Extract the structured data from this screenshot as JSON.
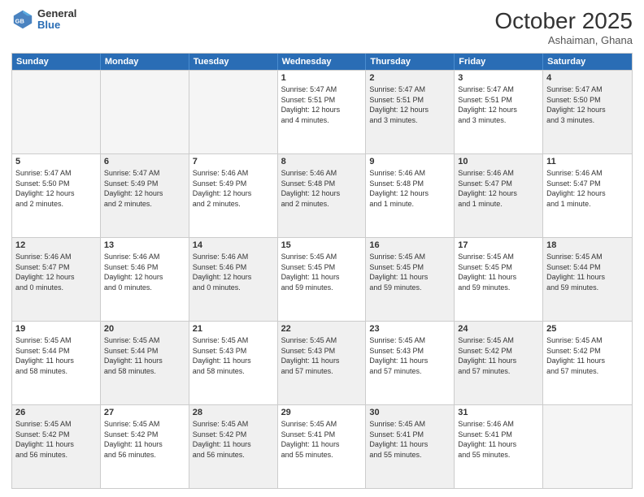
{
  "header": {
    "logo_general": "General",
    "logo_blue": "Blue",
    "month": "October 2025",
    "location": "Ashaiman, Ghana"
  },
  "weekdays": [
    "Sunday",
    "Monday",
    "Tuesday",
    "Wednesday",
    "Thursday",
    "Friday",
    "Saturday"
  ],
  "rows": [
    [
      {
        "day": "",
        "text": "",
        "empty": true
      },
      {
        "day": "",
        "text": "",
        "empty": true
      },
      {
        "day": "",
        "text": "",
        "empty": true
      },
      {
        "day": "1",
        "text": "Sunrise: 5:47 AM\nSunset: 5:51 PM\nDaylight: 12 hours\nand 4 minutes.",
        "shaded": false
      },
      {
        "day": "2",
        "text": "Sunrise: 5:47 AM\nSunset: 5:51 PM\nDaylight: 12 hours\nand 3 minutes.",
        "shaded": true
      },
      {
        "day": "3",
        "text": "Sunrise: 5:47 AM\nSunset: 5:51 PM\nDaylight: 12 hours\nand 3 minutes.",
        "shaded": false
      },
      {
        "day": "4",
        "text": "Sunrise: 5:47 AM\nSunset: 5:50 PM\nDaylight: 12 hours\nand 3 minutes.",
        "shaded": true
      }
    ],
    [
      {
        "day": "5",
        "text": "Sunrise: 5:47 AM\nSunset: 5:50 PM\nDaylight: 12 hours\nand 2 minutes.",
        "shaded": false
      },
      {
        "day": "6",
        "text": "Sunrise: 5:47 AM\nSunset: 5:49 PM\nDaylight: 12 hours\nand 2 minutes.",
        "shaded": true
      },
      {
        "day": "7",
        "text": "Sunrise: 5:46 AM\nSunset: 5:49 PM\nDaylight: 12 hours\nand 2 minutes.",
        "shaded": false
      },
      {
        "day": "8",
        "text": "Sunrise: 5:46 AM\nSunset: 5:48 PM\nDaylight: 12 hours\nand 2 minutes.",
        "shaded": true
      },
      {
        "day": "9",
        "text": "Sunrise: 5:46 AM\nSunset: 5:48 PM\nDaylight: 12 hours\nand 1 minute.",
        "shaded": false
      },
      {
        "day": "10",
        "text": "Sunrise: 5:46 AM\nSunset: 5:47 PM\nDaylight: 12 hours\nand 1 minute.",
        "shaded": true
      },
      {
        "day": "11",
        "text": "Sunrise: 5:46 AM\nSunset: 5:47 PM\nDaylight: 12 hours\nand 1 minute.",
        "shaded": false
      }
    ],
    [
      {
        "day": "12",
        "text": "Sunrise: 5:46 AM\nSunset: 5:47 PM\nDaylight: 12 hours\nand 0 minutes.",
        "shaded": true
      },
      {
        "day": "13",
        "text": "Sunrise: 5:46 AM\nSunset: 5:46 PM\nDaylight: 12 hours\nand 0 minutes.",
        "shaded": false
      },
      {
        "day": "14",
        "text": "Sunrise: 5:46 AM\nSunset: 5:46 PM\nDaylight: 12 hours\nand 0 minutes.",
        "shaded": true
      },
      {
        "day": "15",
        "text": "Sunrise: 5:45 AM\nSunset: 5:45 PM\nDaylight: 11 hours\nand 59 minutes.",
        "shaded": false
      },
      {
        "day": "16",
        "text": "Sunrise: 5:45 AM\nSunset: 5:45 PM\nDaylight: 11 hours\nand 59 minutes.",
        "shaded": true
      },
      {
        "day": "17",
        "text": "Sunrise: 5:45 AM\nSunset: 5:45 PM\nDaylight: 11 hours\nand 59 minutes.",
        "shaded": false
      },
      {
        "day": "18",
        "text": "Sunrise: 5:45 AM\nSunset: 5:44 PM\nDaylight: 11 hours\nand 59 minutes.",
        "shaded": true
      }
    ],
    [
      {
        "day": "19",
        "text": "Sunrise: 5:45 AM\nSunset: 5:44 PM\nDaylight: 11 hours\nand 58 minutes.",
        "shaded": false
      },
      {
        "day": "20",
        "text": "Sunrise: 5:45 AM\nSunset: 5:44 PM\nDaylight: 11 hours\nand 58 minutes.",
        "shaded": true
      },
      {
        "day": "21",
        "text": "Sunrise: 5:45 AM\nSunset: 5:43 PM\nDaylight: 11 hours\nand 58 minutes.",
        "shaded": false
      },
      {
        "day": "22",
        "text": "Sunrise: 5:45 AM\nSunset: 5:43 PM\nDaylight: 11 hours\nand 57 minutes.",
        "shaded": true
      },
      {
        "day": "23",
        "text": "Sunrise: 5:45 AM\nSunset: 5:43 PM\nDaylight: 11 hours\nand 57 minutes.",
        "shaded": false
      },
      {
        "day": "24",
        "text": "Sunrise: 5:45 AM\nSunset: 5:42 PM\nDaylight: 11 hours\nand 57 minutes.",
        "shaded": true
      },
      {
        "day": "25",
        "text": "Sunrise: 5:45 AM\nSunset: 5:42 PM\nDaylight: 11 hours\nand 57 minutes.",
        "shaded": false
      }
    ],
    [
      {
        "day": "26",
        "text": "Sunrise: 5:45 AM\nSunset: 5:42 PM\nDaylight: 11 hours\nand 56 minutes.",
        "shaded": true
      },
      {
        "day": "27",
        "text": "Sunrise: 5:45 AM\nSunset: 5:42 PM\nDaylight: 11 hours\nand 56 minutes.",
        "shaded": false
      },
      {
        "day": "28",
        "text": "Sunrise: 5:45 AM\nSunset: 5:42 PM\nDaylight: 11 hours\nand 56 minutes.",
        "shaded": true
      },
      {
        "day": "29",
        "text": "Sunrise: 5:45 AM\nSunset: 5:41 PM\nDaylight: 11 hours\nand 55 minutes.",
        "shaded": false
      },
      {
        "day": "30",
        "text": "Sunrise: 5:45 AM\nSunset: 5:41 PM\nDaylight: 11 hours\nand 55 minutes.",
        "shaded": true
      },
      {
        "day": "31",
        "text": "Sunrise: 5:46 AM\nSunset: 5:41 PM\nDaylight: 11 hours\nand 55 minutes.",
        "shaded": false
      },
      {
        "day": "",
        "text": "",
        "empty": true
      }
    ]
  ]
}
